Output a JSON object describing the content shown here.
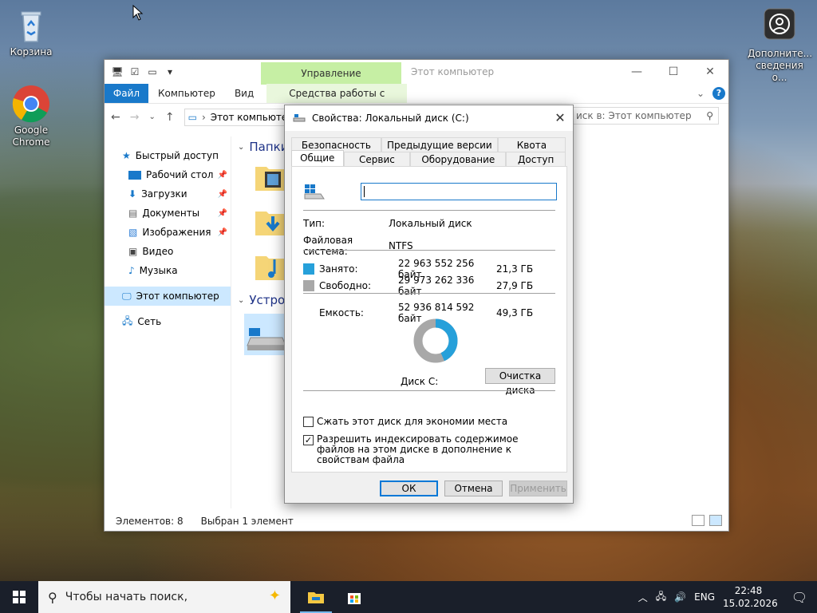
{
  "desktop": {
    "icons": [
      {
        "label": "Корзина",
        "icon": "recycle-bin-icon"
      },
      {
        "label": "Google Chrome",
        "icon": "chrome-icon"
      },
      {
        "label": "Дополните... сведения о...",
        "icon": "user-account-icon"
      }
    ]
  },
  "explorer": {
    "title": "Этот компьютер",
    "manage_label": "Управление",
    "ribbon_tabs": [
      "Файл",
      "Компьютер",
      "Вид",
      "Средства работы с дисками"
    ],
    "address": "Этот компьюте",
    "search_placeholder": "иск в: Этот компьютер",
    "nav": [
      {
        "label": "Быстрый доступ",
        "icon": "star-icon",
        "pinned": false
      },
      {
        "label": "Рабочий стол",
        "icon": "desktop-icon",
        "pinned": true
      },
      {
        "label": "Загрузки",
        "icon": "download-icon",
        "pinned": true
      },
      {
        "label": "Документы",
        "icon": "documents-icon",
        "pinned": true
      },
      {
        "label": "Изображения",
        "icon": "pictures-icon",
        "pinned": true
      },
      {
        "label": "Видео",
        "icon": "video-icon",
        "pinned": false
      },
      {
        "label": "Музыка",
        "icon": "music-icon",
        "pinned": false
      },
      {
        "label": "Этот компьютер",
        "icon": "computer-icon",
        "pinned": false
      },
      {
        "label": "Сеть",
        "icon": "network-icon",
        "pinned": false
      }
    ],
    "groups": [
      "Папки",
      "Устрой"
    ],
    "status_items": "Элементов: 8",
    "status_selected": "Выбран 1 элемент"
  },
  "dialog": {
    "title": "Свойства: Локальный диск (C:)",
    "tabs_top": [
      "Безопасность",
      "Предыдущие версии",
      "Квота"
    ],
    "tabs_bottom": [
      "Общие",
      "Сервис",
      "Оборудование",
      "Доступ"
    ],
    "active_tab": "Общие",
    "name_value": "",
    "type_label": "Тип:",
    "type_value": "Локальный диск",
    "fs_label": "Файловая система:",
    "fs_value": "NTFS",
    "used_label": "Занято:",
    "used_bytes": "22 963 552 256 байт",
    "used_gb": "21,3 ГБ",
    "free_label": "Свободно:",
    "free_bytes": "29 973 262 336 байт",
    "free_gb": "27,9 ГБ",
    "capacity_label": "Емкость:",
    "capacity_bytes": "52 936 814 592 байт",
    "capacity_gb": "49,3 ГБ",
    "used_fraction": 0.434,
    "used_color": "#26a0da",
    "free_color": "#a8a8a8",
    "disk_label": "Диск C:",
    "cleanup_button": "Очистка диска",
    "compress_label": "Сжать этот диск для экономии места",
    "compress_checked": false,
    "index_label": "Разрешить индексировать содержимое файлов на этом диске в дополнение к свойствам файла",
    "index_checked": true,
    "ok": "ОК",
    "cancel": "Отмена",
    "apply": "Применить"
  },
  "taskbar": {
    "search_placeholder": "Чтобы начать поиск,",
    "lang": "ENG",
    "time": "22:48",
    "date": "15.02.2026"
  }
}
